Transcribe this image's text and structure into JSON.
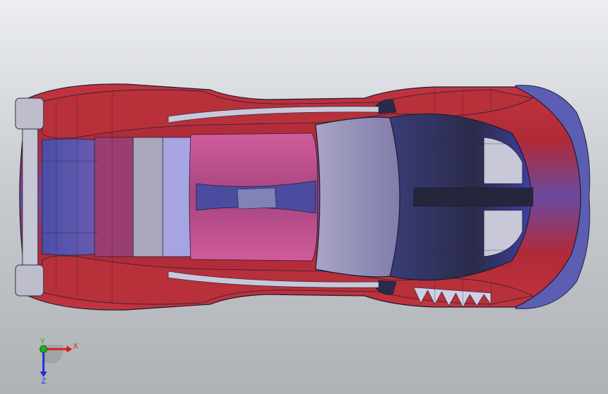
{
  "app": {
    "view": "Top"
  },
  "triad": {
    "x_label": "X",
    "y_label": "Y",
    "z_label": "Z",
    "x_color": "#d81e1e",
    "y_color": "#18b418",
    "z_color": "#1e2ed8"
  },
  "model": {
    "name": "race-car-body",
    "colors": {
      "body_red": "#b8303a",
      "body_pink": "#c8488a",
      "body_blue": "#4a4fa8",
      "body_dark": "#2c2d4a",
      "glass": "#8a88b6",
      "roof_pink": "#c0508e",
      "grey": "#a8a8b8"
    }
  }
}
